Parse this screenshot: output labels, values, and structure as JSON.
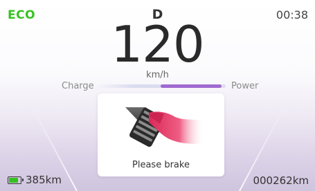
{
  "status": {
    "drive_mode": "ECO",
    "gear": "D",
    "time": "00:38"
  },
  "speedometer": {
    "speed": "120",
    "unit": "km/h"
  },
  "power_meter": {
    "left_label": "Charge",
    "right_label": "Power",
    "level_start": 0.5,
    "level_end": 0.97
  },
  "alert": {
    "icon": "brake-pedal-icon",
    "message": "Please brake"
  },
  "footer": {
    "range": "385km",
    "battery_level": 0.85,
    "odometer": "000262km"
  },
  "colors": {
    "eco": "#35c21f",
    "power_fill": "#a06ad0",
    "battery": "#33c11e",
    "foot": "#e8466e"
  }
}
